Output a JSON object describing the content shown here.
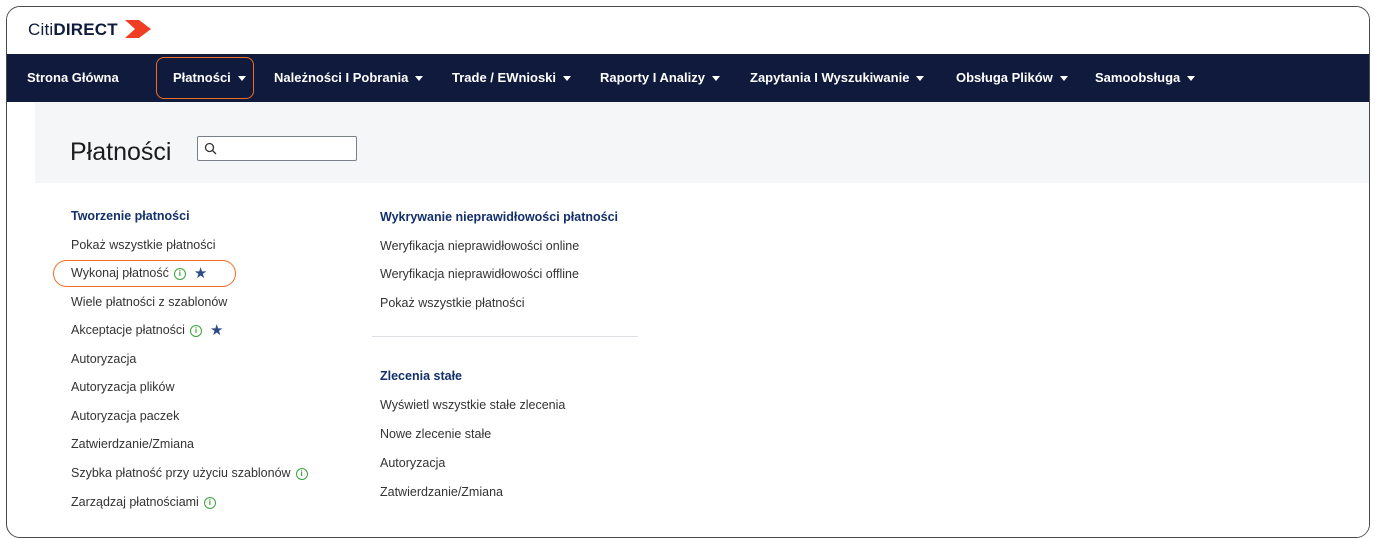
{
  "brand": {
    "citi": "Citi",
    "direct": "DIRECT",
    "accent": "#ef3e23"
  },
  "nav": {
    "items": [
      {
        "label": "Strona Główna",
        "dropdown": false
      },
      {
        "label": "Płatności",
        "dropdown": true
      },
      {
        "label": "Należności I Pobrania",
        "dropdown": true
      },
      {
        "label": "Trade / EWnioski",
        "dropdown": true
      },
      {
        "label": "Raporty I Analizy",
        "dropdown": true
      },
      {
        "label": "Zapytania I Wyszukiwanie",
        "dropdown": true
      },
      {
        "label": "Obsługa Plików",
        "dropdown": true
      },
      {
        "label": "Samoobsługa",
        "dropdown": true
      }
    ]
  },
  "page": {
    "title": "Płatności",
    "search_placeholder": ""
  },
  "left_column": {
    "title": "Tworzenie płatności",
    "items": [
      {
        "label": "Pokaż wszystkie płatności"
      },
      {
        "label": "Wykonaj płatność",
        "info": true,
        "star": true
      },
      {
        "label": "Wiele płatności z szablonów"
      },
      {
        "label": "Akceptacje płatności",
        "info": true,
        "star": true
      },
      {
        "label": "Autoryzacja"
      },
      {
        "label": "Autoryzacja plików"
      },
      {
        "label": "Autoryzacja paczek"
      },
      {
        "label": "Zatwierdzanie/Zmiana"
      },
      {
        "label": "Szybka płatność przy użyciu szablonów",
        "info": true
      },
      {
        "label": "Zarządzaj płatnościami",
        "info": true
      }
    ]
  },
  "right_column": {
    "sections": [
      {
        "title": "Wykrywanie nieprawidłowości płatności",
        "items": [
          {
            "label": "Weryfikacja nieprawidłowości online"
          },
          {
            "label": "Weryfikacja nieprawidłowości offline"
          },
          {
            "label": "Pokaż wszystkie płatności"
          }
        ]
      },
      {
        "title": "Zlecenia stałe",
        "items": [
          {
            "label": "Wyświetl wszystkie stałe zlecenia"
          },
          {
            "label": "Nowe zlecenie stałe"
          },
          {
            "label": "Autoryzacja"
          },
          {
            "label": "Zatwierdzanie/Zmiana"
          }
        ]
      }
    ]
  },
  "colors": {
    "nav_bg": "#0f1a3d",
    "highlight": "#ef6c22",
    "section_title": "#13306b",
    "info": "#3aa43a",
    "star": "#2b4c86"
  }
}
